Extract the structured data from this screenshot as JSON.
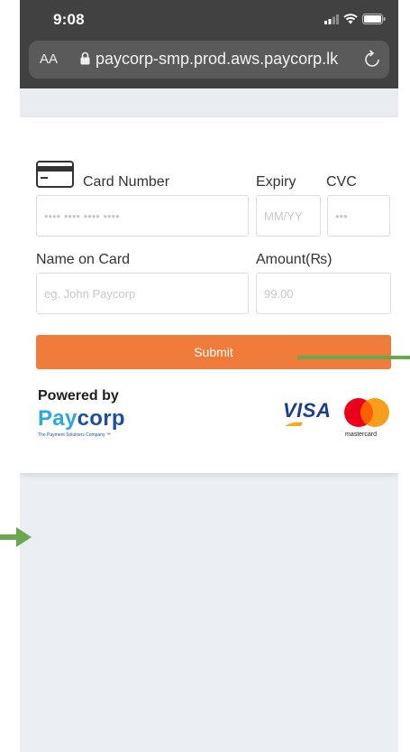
{
  "status_bar": {
    "time": "9:08"
  },
  "browser": {
    "text_size_control": "AA",
    "url": "paycorp-smp.prod.aws.paycorp.lk"
  },
  "form": {
    "card_number": {
      "label": "Card Number",
      "placeholder": "•••• •••• •••• ••••"
    },
    "expiry": {
      "label": "Expiry",
      "placeholder": "MM/YY"
    },
    "cvc": {
      "label": "CVC",
      "placeholder": "•••"
    },
    "name_on_card": {
      "label": "Name on Card",
      "placeholder": "eg. John Paycorp"
    },
    "amount": {
      "label": "Amount(₨)",
      "placeholder": "99.00"
    },
    "submit_label": "Submit"
  },
  "footer": {
    "powered_by": "Powered by",
    "brand_prefix": "Pay",
    "brand_suffix": "corp",
    "tagline": "The Payment Solutions Company ™",
    "visa": "VISA",
    "mastercard": "mastercard"
  },
  "colors": {
    "submit": "#ee7b3a",
    "annotation_arrow": "#6aa84f"
  }
}
